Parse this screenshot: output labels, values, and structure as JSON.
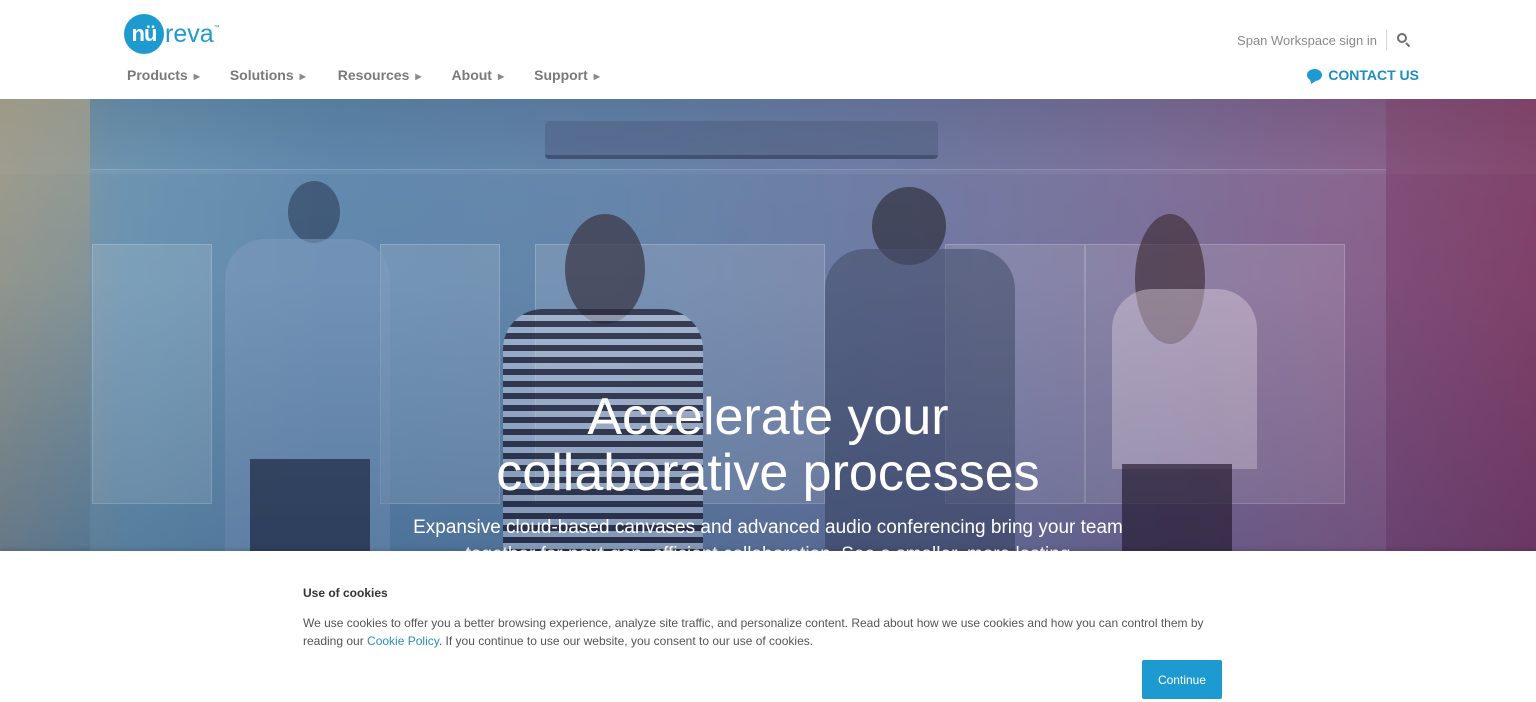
{
  "brand": {
    "logo_mark": "nü",
    "logo_text": "reva",
    "logo_tm": "™",
    "color": "#1d9bd1"
  },
  "header": {
    "nav": [
      {
        "label": "Products",
        "icon": "caret-right-icon"
      },
      {
        "label": "Solutions",
        "icon": "caret-right-icon"
      },
      {
        "label": "Resources",
        "icon": "caret-right-icon"
      },
      {
        "label": "About",
        "icon": "caret-right-icon"
      },
      {
        "label": "Support",
        "icon": "caret-right-icon"
      }
    ],
    "signin_label": "Span Workspace sign in",
    "search_icon": "search-icon",
    "contact_label": "CONTACT US",
    "contact_icon": "chat-bubble-icon"
  },
  "hero": {
    "title_line1": "Accelerate your",
    "title_line2": "collaborative processes",
    "subtitle_line1": "Expansive cloud-based canvases and advanced audio conferencing bring your team",
    "subtitle_line2": "together for next-gen, efficient collaboration. See a smaller, more lasting"
  },
  "cookie_banner": {
    "title": "Use of cookies",
    "text_before_link": "We use cookies to offer you a better browsing experience, analyze site traffic, and personalize content. Read about how we use cookies and how you can control them by reading our ",
    "link_label": "Cookie Policy",
    "text_after_link": ". If you continue to use our website, you consent to our use of cookies.",
    "continue_label": "Continue"
  }
}
